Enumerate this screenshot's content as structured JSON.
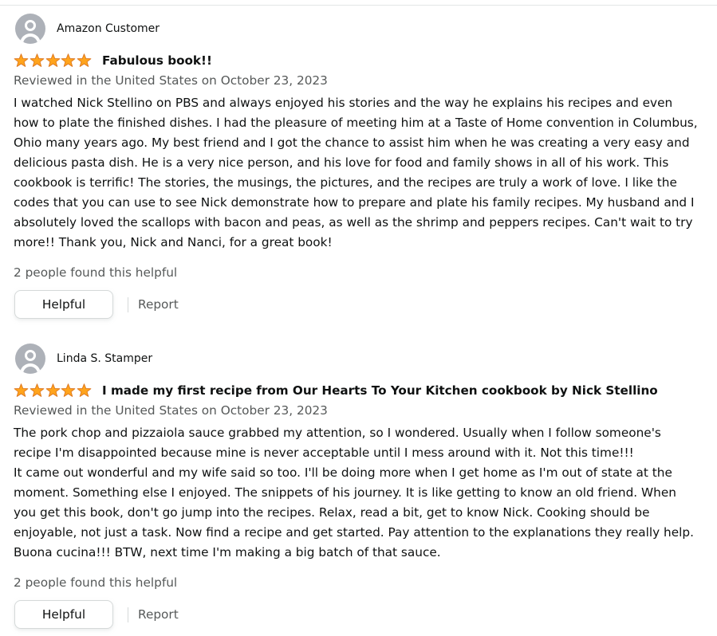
{
  "colors": {
    "star_fill": "#FFA41C",
    "star_stroke": "#DE7921",
    "text_primary": "#0F1111",
    "text_secondary": "#565959",
    "avatar_bg": "#ADB1B8",
    "button_border": "#D5D9D9"
  },
  "reviews": [
    {
      "reviewer_name": "Amazon Customer",
      "rating": 5,
      "rating_max": 5,
      "title": "Fabulous book!!",
      "date_line": "Reviewed in the United States on October 23, 2023",
      "body": [
        "I watched Nick Stellino on PBS and always enjoyed his stories and the way he explains his recipes and even how to plate the finished dishes. I had the pleasure of meeting him at a Taste of Home convention in Columbus, Ohio many years ago. My best friend and I got the chance to assist him when he was creating a very easy and delicious pasta dish. He is a very nice person, and his love for food and family shows in all of his work. This cookbook is terrific! The stories, the musings, the pictures, and the recipes are truly a work of love. I like the codes that you can use to see Nick demonstrate how to prepare and plate his family recipes. My husband and I absolutely loved the scallops with bacon and peas, as well as the shrimp and peppers recipes. Can't wait to try more!! Thank you, Nick and Nanci, for a great book!"
      ],
      "helpful_count_text": "2 people found this helpful",
      "helpful_button_label": "Helpful",
      "report_label": "Report"
    },
    {
      "reviewer_name": "Linda S. Stamper",
      "rating": 5,
      "rating_max": 5,
      "title": "I made my first recipe from Our Hearts To Your Kitchen cookbook by Nick Stellino",
      "date_line": "Reviewed in the United States on October 23, 2023",
      "body": [
        "The pork chop and pizzaiola sauce grabbed my attention, so I wondered. Usually when I follow someone's recipe I'm disappointed because mine is never acceptable until I mess around with it. Not this time!!!",
        "It came out wonderful and my wife said so too. I'll be doing more when I get home as I'm out of state at the moment. Something else I enjoyed. The snippets of his journey. It is like getting to know an old friend. When you get this book, don't go jump into the recipes. Relax, read a bit, get to know Nick. Cooking should be enjoyable, not just a task. Now find a recipe and get started. Pay attention to the explanations they really help. Buona cucina!!! BTW, next time I'm making a big batch of that sauce."
      ],
      "helpful_count_text": "2 people found this helpful",
      "helpful_button_label": "Helpful",
      "report_label": "Report"
    }
  ]
}
